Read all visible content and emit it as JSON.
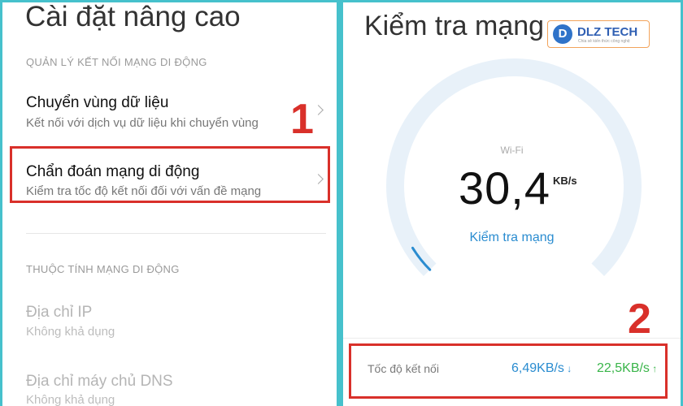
{
  "left": {
    "title": "Cài đặt nâng cao",
    "section1": "QUẢN LÝ KẾT NỐI MẠNG DI ĐỘNG",
    "items": [
      {
        "title": "Chuyển vùng dữ liệu",
        "subtitle": "Kết nối với dịch vụ dữ liệu khi chuyển vùng"
      },
      {
        "title": "Chẩn đoán mạng di động",
        "subtitle": "Kiểm tra tốc độ kết nối đối với vấn đề mạng"
      }
    ],
    "section2": "THUỘC TÍNH MẠNG DI ĐỘNG",
    "props": [
      {
        "title": "Địa chỉ IP",
        "subtitle": "Không khả dụng"
      },
      {
        "title": "Địa chỉ máy chủ DNS",
        "subtitle": "Không khả dụng"
      }
    ],
    "marker": "1"
  },
  "right": {
    "title": "Kiểm tra mạng",
    "logo": {
      "letter": "D",
      "text": "DLZ TECH",
      "tagline": "Chia sẻ kiến thức công nghệ"
    },
    "network": "Wi-Fi",
    "speed": "30,4",
    "unit": "KB/s",
    "check_label": "Kiểm tra mạng",
    "connection_label": "Tốc độ kết nối",
    "download": "6,49KB/s",
    "upload": "22,5KB/s",
    "marker": "2",
    "gauge_level": 0.05
  },
  "colors": {
    "accent": "#2a8cd0",
    "upload": "#3ab54a",
    "highlight": "#d9302a",
    "border": "#46c1cc"
  }
}
